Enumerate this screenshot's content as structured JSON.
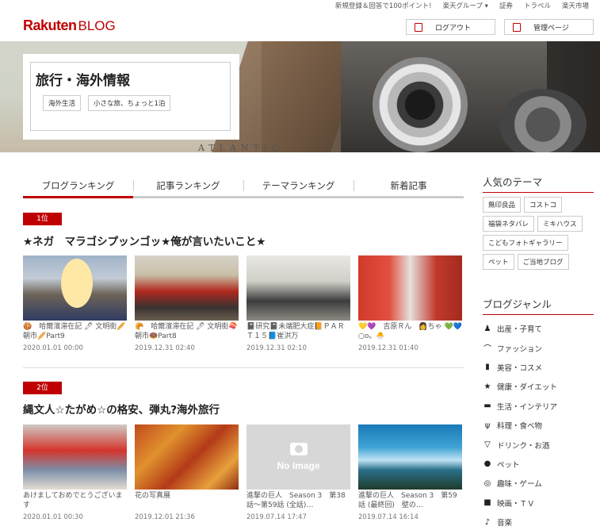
{
  "topbar": {
    "links": [
      "新規登録＆回答で100ポイント!",
      "楽天グループ ▾",
      "証券",
      "トラベル",
      "楽天市場"
    ]
  },
  "header": {
    "logo_main": "Rakuten",
    "logo_sub": "BLOG",
    "logout_label": "ログアウト",
    "admin_label": "管理ページ"
  },
  "hero": {
    "map_text": "ATLANTIC",
    "blog_title": "旅行・海外情報",
    "tags": [
      "海外生活",
      "小さな旅、ちょっと1泊"
    ]
  },
  "tabs": [
    "ブログランキング",
    "記事ランキング",
    "テーマランキング",
    "新着記事"
  ],
  "rankings": [
    {
      "rank": "1位",
      "title": "★ネガ　マラゴシプッンゴッ★俺が言いたいこと★",
      "posts": [
        {
          "caption": "🍪　哈爾濱滞在記 🖊 文明街🥖朝市🥖Part9",
          "date": "2020.01.01 00:00"
        },
        {
          "caption": "🥐　哈爾濱滞在記 🖊 文明街🍣朝市🍩Part8",
          "date": "2019.12.31 02:40"
        },
        {
          "caption": "📓研究📓未端肥大症📙ＰＡＲＴ１５📘崔洪万",
          "date": "2019.12.31 02:10"
        },
        {
          "caption": "💛💜　吉原Ｒん　👩ちゃ 💚💙　○o。🐣",
          "date": "2019.12.31 01:40"
        }
      ]
    },
    {
      "rank": "2位",
      "title": "縄文人☆たがめ☆の格安、弾丸?海外旅行",
      "posts": [
        {
          "caption": "あけましておめでとうございます",
          "date": "2020.01.01 00:30"
        },
        {
          "caption": "花の写真展",
          "date": "2019.12.01 21:36"
        },
        {
          "caption": "進撃の巨人　Season 3　第38話～第59話 (全話)…",
          "date": "2019.07.14 17:47",
          "no_image": "No Image"
        },
        {
          "caption": "進撃の巨人　Season 3　第59話 (最終回)　壁の…",
          "date": "2019.07.14 16:14"
        }
      ]
    }
  ],
  "sidebar": {
    "popular_heading": "人気のテーマ",
    "themes": [
      "無印良品",
      "コストコ",
      "福袋ネタバレ",
      "ミキハウス",
      "こどもフォトギャラリー",
      "ペット",
      "ご当地ブログ"
    ],
    "genre_heading": "ブログジャンル",
    "genres": [
      {
        "label": "出産・子育て",
        "icon": "baby-icon"
      },
      {
        "label": "ファッション",
        "icon": "hat-icon"
      },
      {
        "label": "美容・コスメ",
        "icon": "lipstick-icon"
      },
      {
        "label": "健康・ダイエット",
        "icon": "runner-icon"
      },
      {
        "label": "生活・インテリア",
        "icon": "sofa-icon"
      },
      {
        "label": "料理・食べ物",
        "icon": "cutlery-icon"
      },
      {
        "label": "ドリンク・お酒",
        "icon": "wine-icon"
      },
      {
        "label": "ペット",
        "icon": "paw-icon"
      },
      {
        "label": "趣味・ゲーム",
        "icon": "gamepad-icon"
      },
      {
        "label": "映画・ＴＶ",
        "icon": "video-camera-icon"
      },
      {
        "label": "音楽",
        "icon": "music-note-icon"
      }
    ]
  }
}
